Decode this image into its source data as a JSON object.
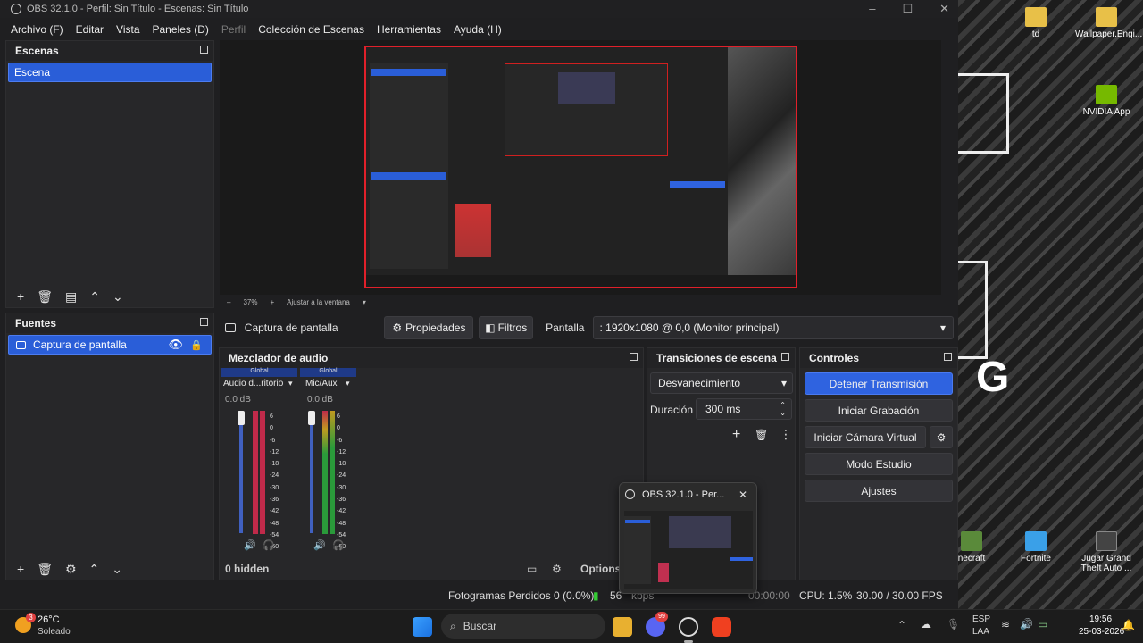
{
  "window": {
    "title": "OBS 32.1.0 - Perfil: Sin Título - Escenas: Sin Título"
  },
  "menu": {
    "items": [
      "Archivo (F)",
      "Editar",
      "Vista",
      "Paneles (D)",
      "Perfil",
      "Colección de Escenas",
      "Herramientas",
      "Ayuda (H)"
    ]
  },
  "scenes": {
    "title": "Escenas",
    "items": [
      "Escena"
    ]
  },
  "sources": {
    "title": "Fuentes",
    "items": [
      "Captura de pantalla"
    ]
  },
  "preview_bar": {
    "zoom": "37%",
    "fit": "Ajustar a la ventana"
  },
  "source_bar": {
    "selected": "Captura de pantalla",
    "properties": "Propiedades",
    "filters": "Filtros",
    "display_label": "Pantalla",
    "display_value": ": 1920x1080 @ 0,0 (Monitor principal)"
  },
  "mixer": {
    "title": "Mezclador de audio",
    "channels": [
      {
        "group": "Global",
        "name": "Audio d...ritorio",
        "db": "0.0 dB"
      },
      {
        "group": "Global",
        "name": "Mic/Aux",
        "db": "0.0 dB"
      }
    ],
    "scale": [
      "6",
      "0",
      "-6",
      "-12",
      "-18",
      "-24",
      "-30",
      "-36",
      "-42",
      "-48",
      "-54",
      "-60"
    ],
    "hidden": "0 hidden",
    "options": "Options"
  },
  "transitions": {
    "title": "Transiciones de escena",
    "selected": "Desvanecimiento",
    "duration_label": "Duración",
    "duration_value": "300 ms"
  },
  "controls": {
    "title": "Controles",
    "stop_stream": "Detener Transmisión",
    "start_record": "Iniciar Grabación",
    "virtual_cam": "Iniciar Cámara Virtual",
    "studio": "Modo Estudio",
    "settings": "Ajustes"
  },
  "status": {
    "dropped": "Fotogramas Perdidos 0 (0.0%)",
    "bitrate": "56",
    "kbps": "kbps",
    "time": "00:00:00",
    "cpu": "CPU: 1.5%",
    "fps": "30.00 / 30.00 FPS"
  },
  "taskbar_preview": {
    "title": "OBS 32.1.0 - Per..."
  },
  "desktop": {
    "icons": [
      "td",
      "Wallpaper.Engi...",
      "NVIDIA App",
      "necraft",
      "Fortnite",
      "Jugar Grand Theft Auto ..."
    ]
  },
  "taskbar": {
    "weather_temp": "26°C",
    "weather_desc": "Soleado",
    "weather_badge": "3",
    "search": "Buscar",
    "discord_badge": "99",
    "lang1": "ESP",
    "lang2": "LAA",
    "time": "19:56",
    "date": "25-03-2026"
  },
  "colors": {
    "accent": "#2f63e0",
    "panel": "#272729",
    "preview_border": "#e0202a"
  }
}
